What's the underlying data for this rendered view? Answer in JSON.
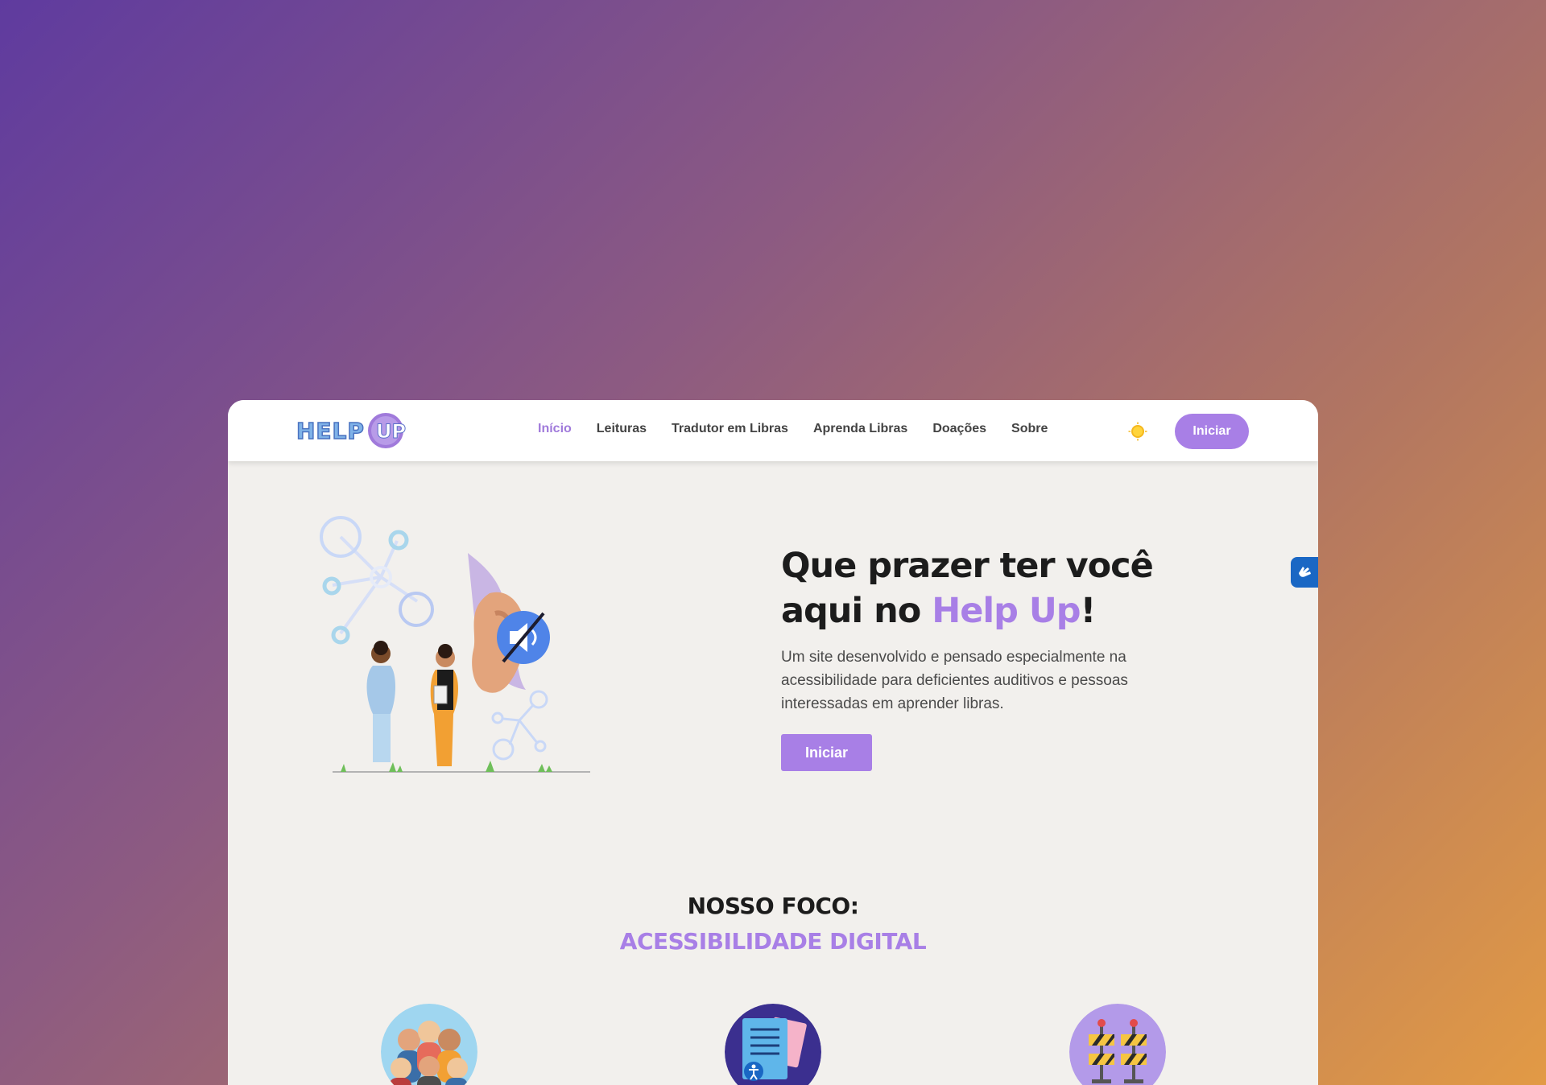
{
  "navbar": {
    "logo_text": "HELP UP",
    "links": [
      {
        "label": "Início",
        "active": true
      },
      {
        "label": "Leituras",
        "active": false
      },
      {
        "label": "Tradutor em Libras",
        "active": false
      },
      {
        "label": "Aprenda Libras",
        "active": false
      },
      {
        "label": "Doações",
        "active": false
      },
      {
        "label": "Sobre",
        "active": false
      }
    ],
    "theme_icon": "sun-icon",
    "cta_label": "Iniciar"
  },
  "hero": {
    "title_line1": "Que prazer ter você",
    "title_prefix": "aqui no ",
    "title_brand": "Help Up",
    "title_suffix": "!",
    "description": "Um site desenvolvido e pensado especialmente na acessibilidade para deficientes auditivos e pessoas interessadas em aprender libras.",
    "cta_label": "Iniciar",
    "illustration_icon": "hearing-impaired-illustration"
  },
  "accessibility_widget": {
    "icon": "sign-language-hand-icon"
  },
  "focus": {
    "title": "NOSSO FOCO:",
    "subtitle": "ACESSIBILIDADE DIGITAL",
    "icons": [
      "people-group-icon",
      "accessible-document-icon",
      "barrier-icon"
    ]
  },
  "colors": {
    "accent": "#a87fe6",
    "nav_text": "#434343",
    "page_bg": "#f2f0ed",
    "widget_blue": "#1a67c4"
  }
}
